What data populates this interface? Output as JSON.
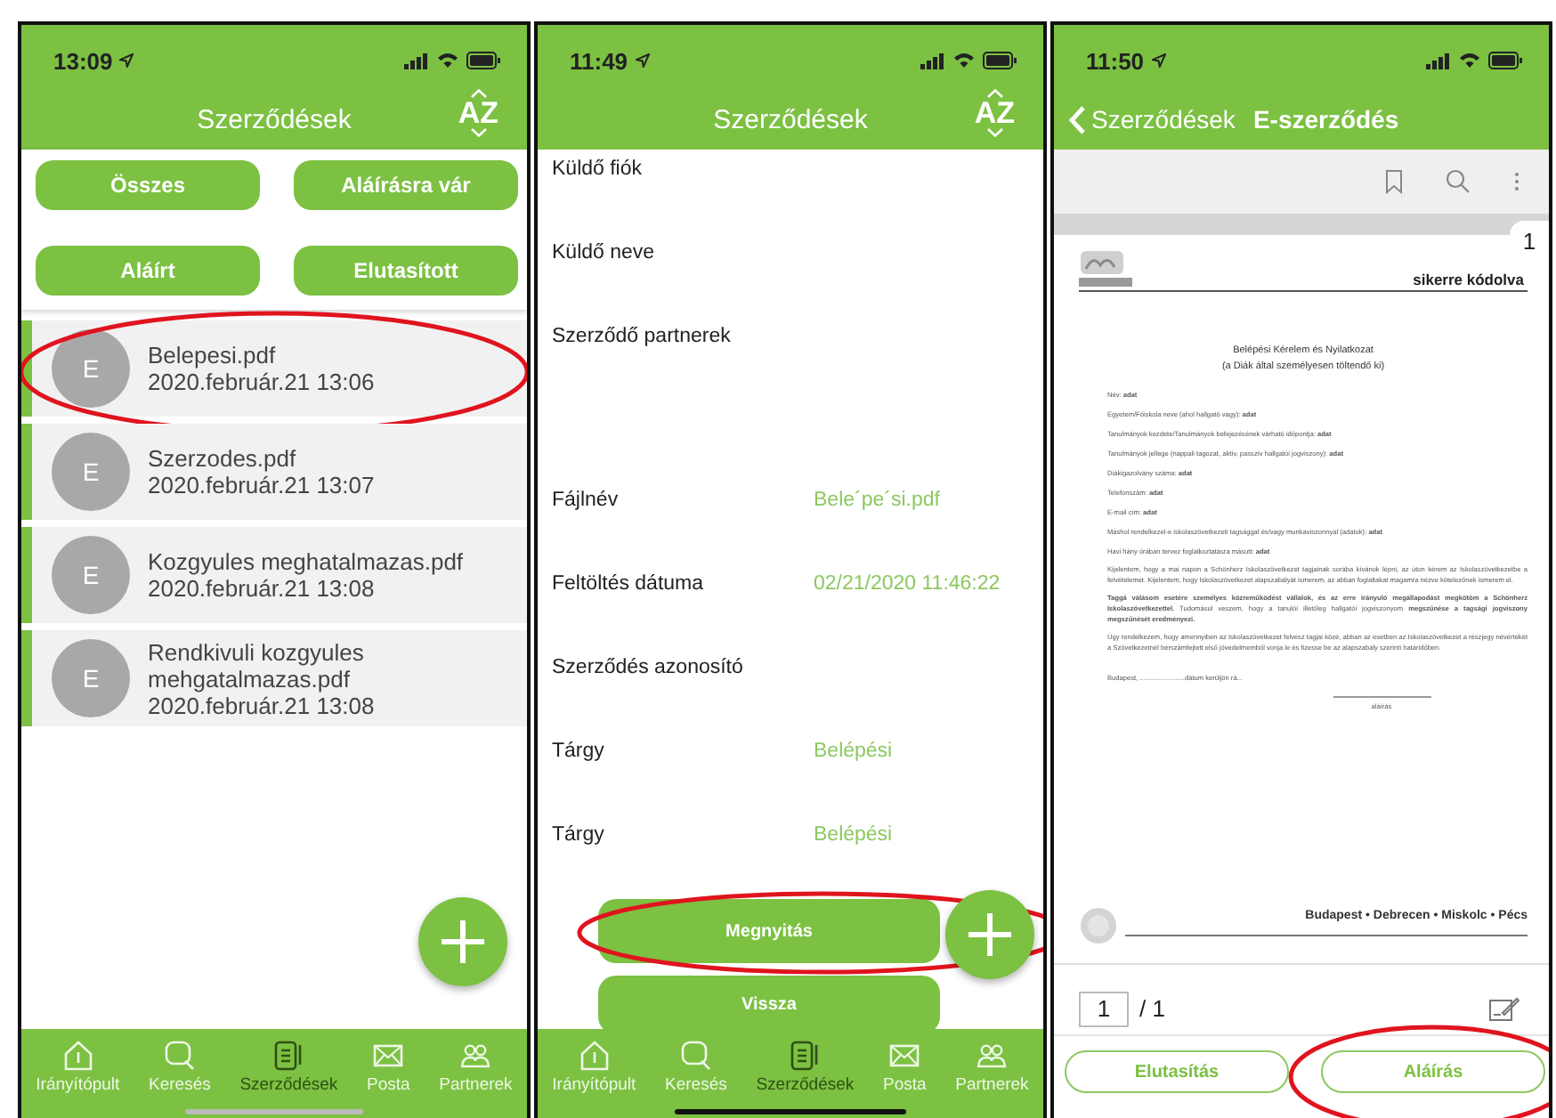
{
  "screens": [
    {
      "kind": "list",
      "time": "13:09",
      "title": "Szerződések",
      "sort_label": "AZ",
      "filters": [
        "Összes",
        "Aláírásra vár",
        "Aláírt",
        "Elutasított"
      ],
      "items": [
        {
          "avatar": "E",
          "name": "Belepesi.pdf",
          "date": "2020.február.21 13:06",
          "circled": true
        },
        {
          "avatar": "E",
          "name": "Szerzodes.pdf",
          "date": "2020.február.21 13:07",
          "circled": false
        },
        {
          "avatar": "E",
          "name": "Kozgyules meghatalmazas.pdf",
          "date": "2020.február.21 13:08",
          "circled": false
        },
        {
          "avatar": "E",
          "name": "Rendkivuli kozgyules mehgatalmazas.pdf",
          "date": "2020.február.21 13:08",
          "circled": false
        }
      ],
      "tabs": [
        {
          "label": "Irányítópult",
          "selected": false
        },
        {
          "label": "Keresés",
          "selected": false
        },
        {
          "label": "Szerződések",
          "selected": true
        },
        {
          "label": "Posta",
          "selected": false
        },
        {
          "label": "Partnerek",
          "selected": false
        }
      ]
    },
    {
      "kind": "details",
      "time": "11:49",
      "title": "Szerződések",
      "sort_label": "AZ",
      "fields": [
        {
          "kind": "text",
          "label": "Küldő fiók"
        },
        {
          "kind": "text",
          "label": "Küldő neve"
        },
        {
          "kind": "multiline",
          "label": "Szerződő partnerek"
        },
        {
          "kind": "text",
          "label": "Fájlnév",
          "value": "Bele´pe´si.pdf"
        },
        {
          "kind": "text",
          "label": "Feltöltés dátuma",
          "value": "02/21/2020 11:46:22"
        },
        {
          "kind": "text",
          "label": "Szerződés azonosító"
        },
        {
          "kind": "text",
          "label": "Tárgy",
          "value": "Belépési"
        },
        {
          "kind": "text",
          "label": "Tárgy",
          "value": "Belépési"
        }
      ],
      "buttons": [
        {
          "label": "Megnyitás",
          "circled": true
        },
        {
          "label": "Vissza",
          "circled": false
        }
      ],
      "tabs": [
        {
          "label": "Irányítópult",
          "selected": false
        },
        {
          "label": "Keresés",
          "selected": false
        },
        {
          "label": "Szerződések",
          "selected": true
        },
        {
          "label": "Posta",
          "selected": false
        },
        {
          "label": "Partnerek",
          "selected": false
        }
      ]
    },
    {
      "kind": "viewer",
      "time": "11:50",
      "back": "Szerződések",
      "title": "E-szerződés",
      "page_badge": "1",
      "document": {
        "stamp": "sikerre kódolva",
        "title": "Belépési Kérelem és Nyilatkozat",
        "subtitle": "(a Diák által személyesen töltendő ki)",
        "fields": [
          "Név: **adat**",
          "Egyetem/Főiskola neve (ahol hallgató vagy): **adat**",
          "Tanulmányok kezdete/Tanulmányok befejezésének várható időpontja: **adat**",
          "Tanulmányok jellege (nappali tagozat, aktív, passzív hallgatói jogviszony): **adat**",
          "Diákigazolvány száma: **adat**",
          "Telefonszám: **adat**",
          "E-mail cím: **adat**",
          "Máshol rendelkezel-e iskolaszövetkezeti tagsággal és/vagy munkaviszonnyal (adatok): **adat**",
          "Havi hány órában tervez foglalkoztatásra másutt: **adat**"
        ],
        "paragraphs": [
          "Kijelentem, hogy a mai napon a Schönherz Iskolaszövetkezet tagjainak sorába kívánok lépni, az úton kérem az Iskolaszövetkezetbe a felvételemet. Kijelentem, hogy Iskolaszövetkezet alapszabályát ismerem, az abban foglaltakat magamra nézve kötelezőnek ismerem el.",
          "**Taggá válásom esetére személyes közreműködést vállalok, és az erre irányuló megállapodást megkötöm a Schönherz Iskolaszövetkezettel.** Tudomásul veszem, hogy a tanulói illetőleg hallgatói jogviszonyom **megszűnése a tagsági jogviszony megszűnését eredményezi.**",
          "Úgy rendelkezem, hogy amennyiben az Iskolaszövetkezet felvesz tagjai közé, abban az esetben az Iskolaszövetkezet a részjegy névértékét a Szövetkezetnél bérszámfejtett első jövedelmemből vonja le és fizesse be az alapszabály szerinti határidőben."
        ],
        "place_line": "Budapest, ........................dátum kerüljön rá...",
        "signature": "aláírás",
        "footer": "Budapest • Debrecen • Miskolc • Pécs"
      },
      "pager": {
        "current": "1",
        "total": "/ 1"
      },
      "buttons": [
        {
          "label": "Elutasítás",
          "circled": false
        },
        {
          "label": "Aláírás",
          "circled": true
        }
      ]
    }
  ]
}
